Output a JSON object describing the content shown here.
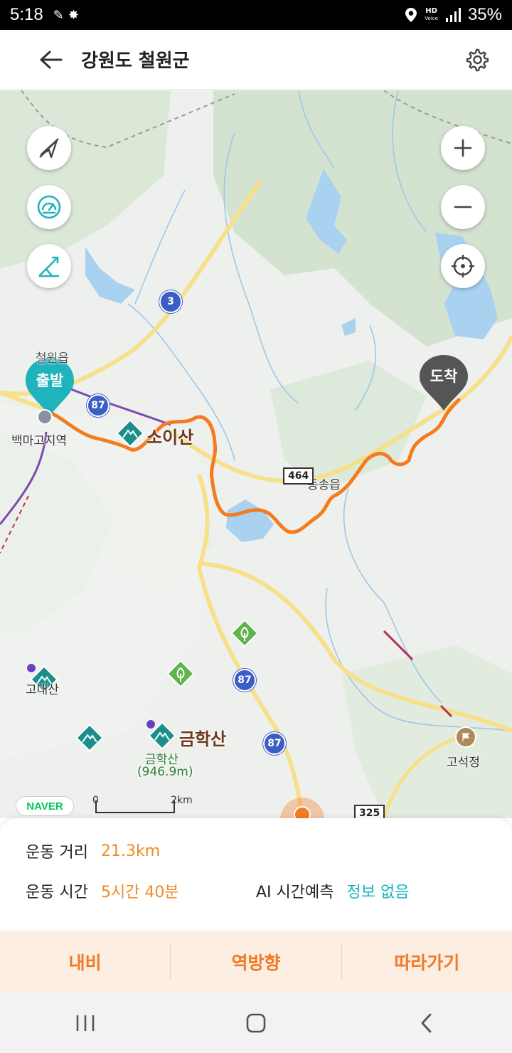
{
  "status_bar": {
    "time": "5:18",
    "battery": "35%",
    "hd_label": "HD",
    "voice_label": "Voice"
  },
  "header": {
    "title": "강원도 철원군",
    "back_icon": "arrow-left-icon",
    "settings_icon": "gear-icon"
  },
  "map": {
    "controls_left": [
      "compass-off-icon",
      "speed-gauge-icon",
      "slope-icon"
    ],
    "controls_right": [
      "zoom-in-icon",
      "zoom-out-icon",
      "locate-icon"
    ],
    "start_label": "출발",
    "end_label": "도착",
    "places": {
      "town_top": "철원읍",
      "station": "백마고지역",
      "mountain_soi": "소이산",
      "town_dongsong": "동송읍",
      "mountain_left": "고대산",
      "mountain_geumhak": "금학산",
      "geumhak_sub": "금학산",
      "geumhak_elev": "(946.9m)",
      "goseokjeong": "고석정"
    },
    "roads": {
      "r3": "3",
      "r87a": "87",
      "r87b": "87",
      "r87c": "87",
      "r464": "464",
      "r325": "325"
    },
    "naver_logo": "NAVER",
    "scale_zero": "0",
    "scale_max": "2km",
    "colors": {
      "route": "#f47b20",
      "water": "#a8d2f0",
      "forest": "#d3e3d0",
      "teal": "#1fb3bd",
      "road_yellow": "#f7e08a"
    }
  },
  "info": {
    "distance_label": "운동 거리",
    "distance_value": "21.3km",
    "time_label": "운동 시간",
    "time_value": "5시간 40분",
    "ai_label": "AI 시간예측",
    "ai_value": "정보 없음"
  },
  "actions": {
    "navi": "내비",
    "reverse": "역방향",
    "follow": "따라가기"
  },
  "nav_bar": {
    "recents_icon": "recents-icon",
    "home_icon": "home-icon",
    "back_icon": "back-icon"
  }
}
